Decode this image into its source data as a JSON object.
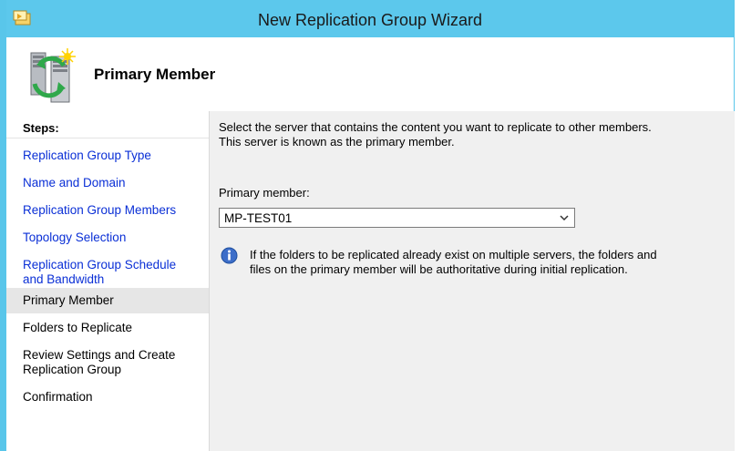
{
  "window": {
    "title": "New Replication Group Wizard"
  },
  "header": {
    "title": "Primary Member"
  },
  "steps": {
    "heading": "Steps:",
    "items": [
      {
        "label": "Replication Group Type",
        "state": "link"
      },
      {
        "label": "Name and Domain",
        "state": "link"
      },
      {
        "label": "Replication Group Members",
        "state": "link"
      },
      {
        "label": "Topology Selection",
        "state": "link"
      },
      {
        "label": "Replication Group Schedule and Bandwidth",
        "state": "link"
      },
      {
        "label": "Primary Member",
        "state": "current"
      },
      {
        "label": "Folders to Replicate",
        "state": "plain"
      },
      {
        "label": "Review Settings and Create Replication Group",
        "state": "plain"
      },
      {
        "label": "Confirmation",
        "state": "plain"
      }
    ]
  },
  "main": {
    "intro_line1": "Select the server that contains the content you want to replicate to other members.",
    "intro_line2": "This server is known as the primary member.",
    "primary_member_label": "Primary member:",
    "primary_member_value": "MP-TEST01",
    "info_line1": "If the folders to be replicated already exist on multiple servers, the folders and",
    "info_line2": "files on the primary member will be authoritative during initial replication."
  },
  "icons": {
    "title": "wizard-folder-icon",
    "header": "server-replication-icon",
    "info": "info-icon",
    "dropdown": "chevron-down-icon"
  },
  "colors": {
    "titlebar": "#5cc8ec",
    "link": "#0a2fd6",
    "current_step_bg": "#e6e6e6",
    "content_bg": "#f0f0f0"
  }
}
